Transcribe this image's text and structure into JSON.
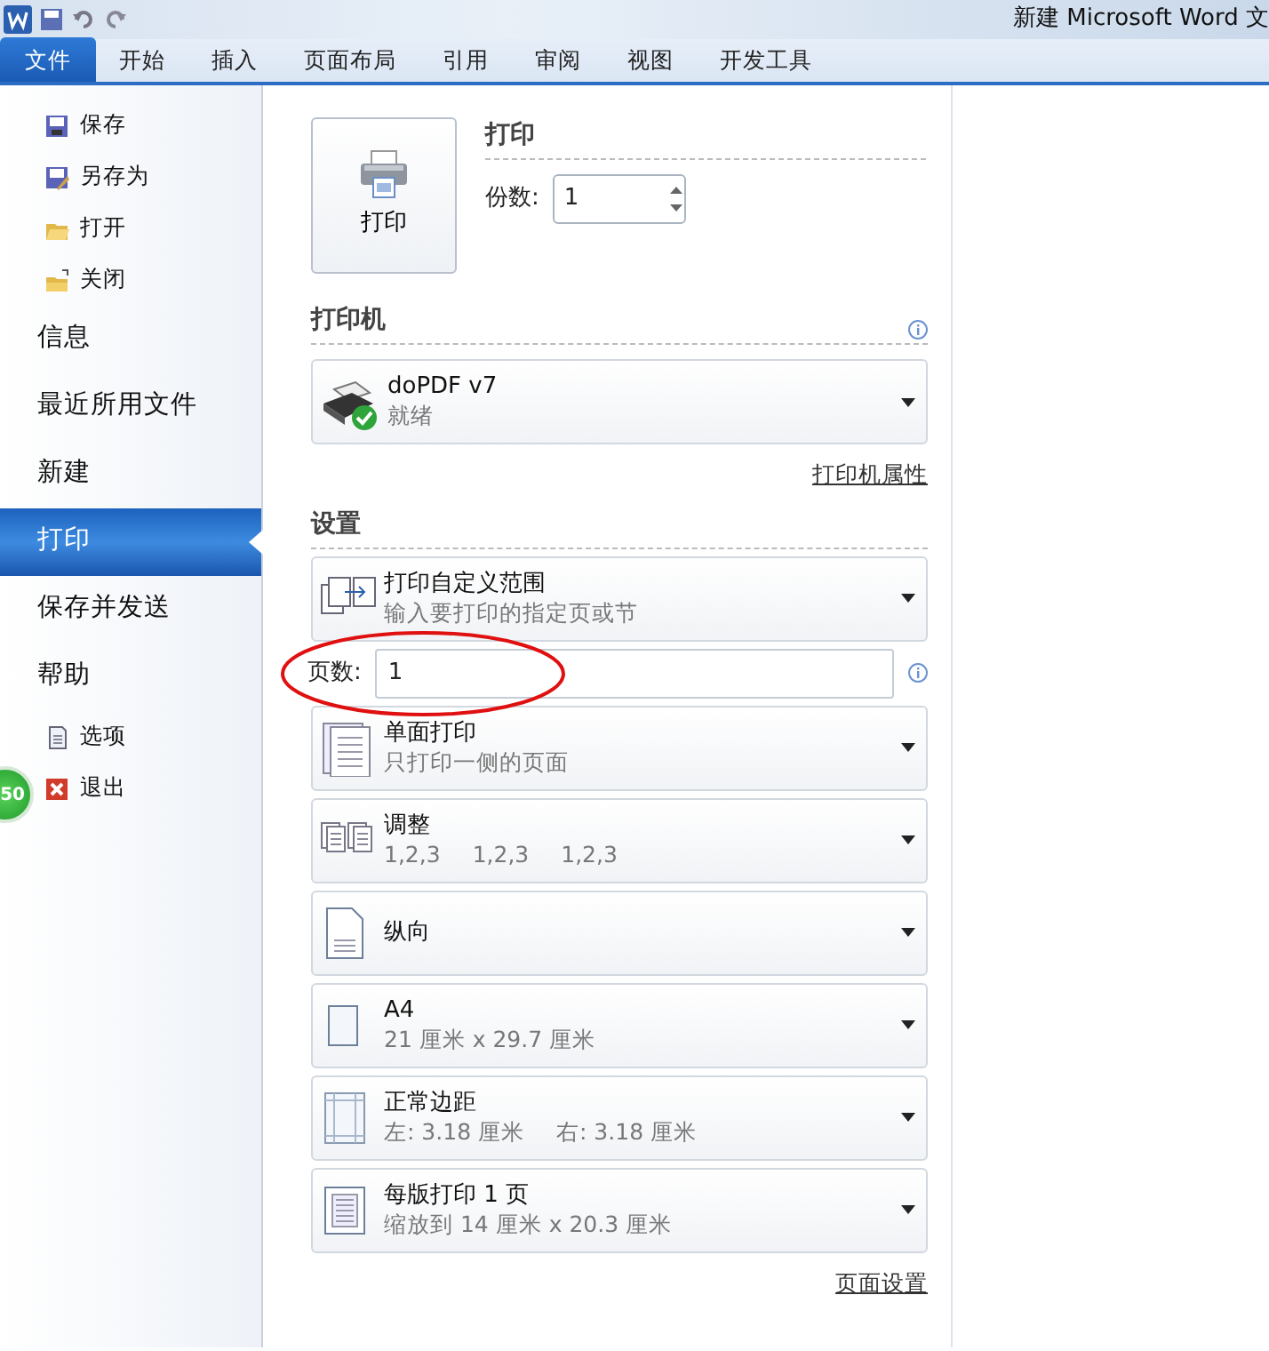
{
  "window": {
    "title": "新建 Microsoft Word 文"
  },
  "ribbon_tabs": [
    {
      "label": "文件",
      "selected": true
    },
    {
      "label": "开始",
      "selected": false
    },
    {
      "label": "插入",
      "selected": false
    },
    {
      "label": "页面布局",
      "selected": false
    },
    {
      "label": "引用",
      "selected": false
    },
    {
      "label": "审阅",
      "selected": false
    },
    {
      "label": "视图",
      "selected": false
    },
    {
      "label": "开发工具",
      "selected": false
    }
  ],
  "sidebar": {
    "items": [
      {
        "label": "保存",
        "kind": "command",
        "selected": false
      },
      {
        "label": "另存为",
        "kind": "command",
        "selected": false
      },
      {
        "label": "打开",
        "kind": "command",
        "selected": false
      },
      {
        "label": "关闭",
        "kind": "command",
        "selected": false
      },
      {
        "label": "信息",
        "kind": "page",
        "selected": false
      },
      {
        "label": "最近所用文件",
        "kind": "page",
        "selected": false
      },
      {
        "label": "新建",
        "kind": "page",
        "selected": false
      },
      {
        "label": "打印",
        "kind": "page",
        "selected": true
      },
      {
        "label": "保存并发送",
        "kind": "page",
        "selected": false
      },
      {
        "label": "帮助",
        "kind": "page",
        "selected": false
      },
      {
        "label": "选项",
        "kind": "command",
        "selected": false
      },
      {
        "label": "退出",
        "kind": "command",
        "selected": false
      }
    ]
  },
  "floating_badge": "50",
  "print": {
    "button": "打印",
    "heading": "打印",
    "copies_label": "份数:",
    "copies": "1"
  },
  "printer": {
    "heading": "打印机",
    "name": "doPDF v7",
    "status": "就绪",
    "properties_link": "打印机属性"
  },
  "settings": {
    "heading": "设置",
    "rows": [
      {
        "title": "打印自定义范围",
        "subtitle": [
          "输入要打印的指定页或节"
        ]
      },
      {
        "title": "单面打印",
        "subtitle": [
          "只打印一侧的页面"
        ]
      },
      {
        "title": "调整",
        "subtitle": [
          "1,2,3",
          "1,2,3",
          "1,2,3"
        ]
      },
      {
        "title": "纵向",
        "subtitle": []
      },
      {
        "title": "A4",
        "subtitle": [
          "21 厘米 x 29.7 厘米"
        ]
      },
      {
        "title": "正常边距",
        "subtitle": [
          "左:  3.18 厘米",
          "右:  3.18 厘米"
        ]
      },
      {
        "title": "每版打印 1 页",
        "subtitle": [
          "缩放到 14 厘米 x 20.3 厘米"
        ]
      }
    ],
    "pages_label": "页数:",
    "pages": "1",
    "page_setup_link": "页面设置"
  }
}
